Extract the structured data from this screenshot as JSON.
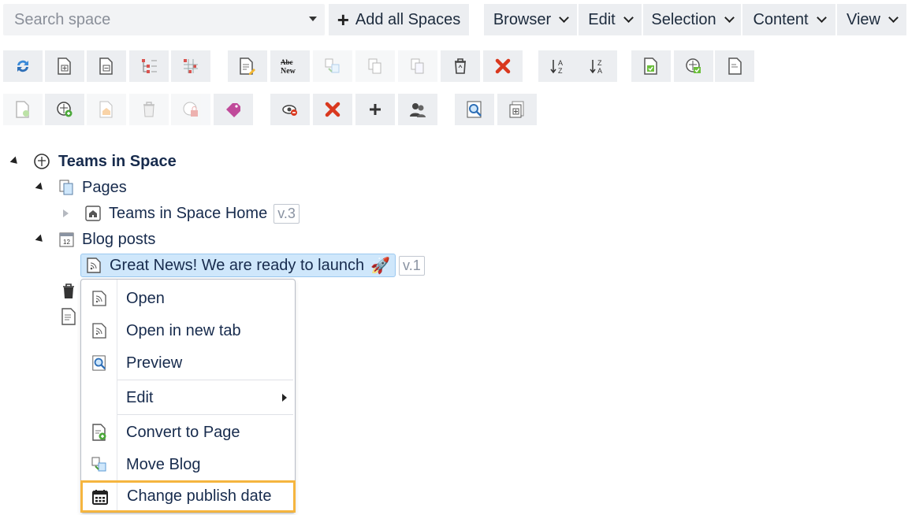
{
  "topbar": {
    "search_placeholder": "Search space",
    "add_all_label": "Add all Spaces",
    "menus": [
      "Browser",
      "Edit",
      "Selection",
      "Content",
      "View"
    ]
  },
  "tree": {
    "space": "Teams in Space",
    "pages_label": "Pages",
    "home_label": "Teams in Space Home",
    "home_version": "v.3",
    "blog_label": "Blog posts",
    "post_label": "Great News! We are ready to launch",
    "post_emoji": "🚀",
    "post_version": "v.1"
  },
  "context_menu": {
    "items": [
      "Open",
      "Open in new tab",
      "Preview",
      "Edit",
      "Convert to Page",
      "Move Blog",
      "Change publish date"
    ]
  },
  "colors": {
    "highlight": "#f5b53f",
    "selected_bg": "#cfe7fb",
    "button_bg": "#eceef1"
  }
}
